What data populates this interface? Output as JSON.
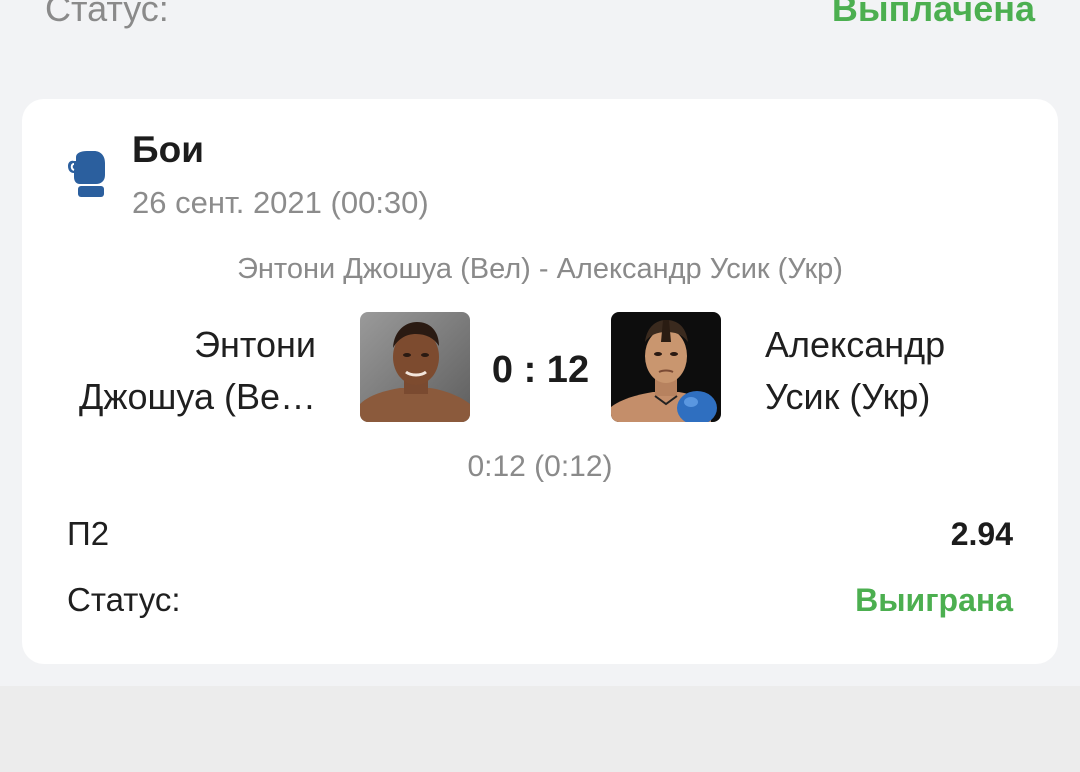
{
  "previous_bet": {
    "status_label": "Статус:",
    "status_value": "Выплачена"
  },
  "event": {
    "sport_icon": "boxing-glove-icon",
    "sport": "Бои",
    "date": "26 сент. 2021 (00:30)",
    "match_name": "Энтони Джошуа (Вел) - Александр Усик (Укр)",
    "team_left": {
      "line1": "Энтони",
      "line2": "Джошуа (Ве…"
    },
    "team_right": {
      "line1": "Александр",
      "line2": "Усик (Укр)"
    },
    "score": "0 : 12",
    "score_detail": "0:12 (0:12)"
  },
  "bet": {
    "name": "П2",
    "odds": "2.94",
    "status_label": "Статус:",
    "status_value": "Выиграна"
  },
  "colors": {
    "status_won": "#4caf50",
    "icon_blue": "#2b5f9e",
    "card_background": "#ffffff",
    "page_background": "#f2f3f5"
  }
}
